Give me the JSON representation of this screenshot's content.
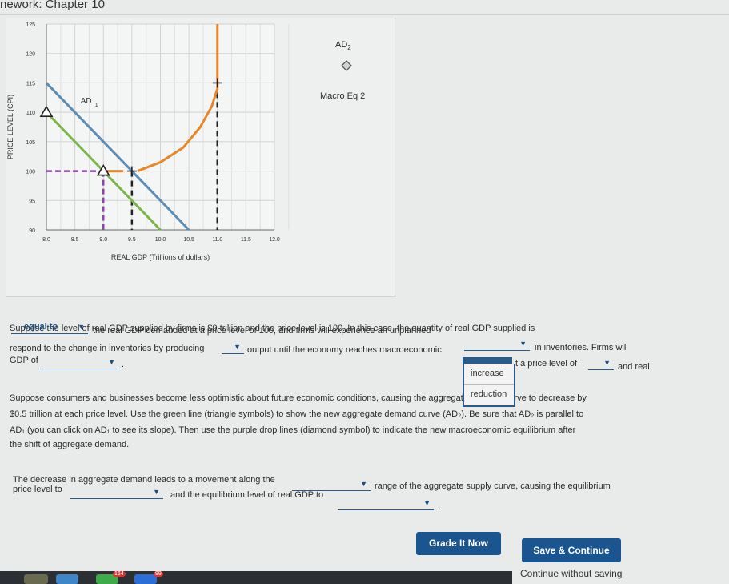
{
  "header": {
    "title": "nework: Chapter 10"
  },
  "chart_data": {
    "type": "line",
    "xlabel": "REAL GDP (Trillions of dollars)",
    "ylabel": "PRICE LEVEL (CPI)",
    "xlim": [
      8.0,
      12.0
    ],
    "ylim": [
      90,
      125
    ],
    "x_ticks": [
      "8.0",
      "8.5",
      "9.0",
      "9.5",
      "10.0",
      "10.5",
      "11.0",
      "11.5",
      "12.0"
    ],
    "y_ticks": [
      "90",
      "95",
      "100",
      "105",
      "110",
      "115",
      "120",
      "125"
    ],
    "grid": true,
    "series": [
      {
        "name": "AD1",
        "color": "#5b8db5",
        "points": [
          [
            8.0,
            115
          ],
          [
            10.5,
            90
          ]
        ]
      },
      {
        "name": "AD2",
        "color": "#7ab648",
        "points": [
          [
            8.0,
            110
          ],
          [
            10.0,
            90
          ]
        ],
        "markers": "triangle",
        "marker_points": [
          [
            8.0,
            110
          ],
          [
            9.0,
            100
          ]
        ]
      },
      {
        "name": "AS",
        "color": "#e8872a",
        "points": [
          [
            9.0,
            100
          ],
          [
            9.35,
            100
          ],
          [
            9.6,
            100
          ],
          [
            10.0,
            101.5
          ],
          [
            10.4,
            104
          ],
          [
            10.7,
            107.5
          ],
          [
            10.9,
            111
          ],
          [
            11.0,
            114
          ],
          [
            11.0,
            115
          ],
          [
            11.0,
            125
          ]
        ],
        "markers": "cross",
        "marker_points": [
          [
            9.5,
            100
          ],
          [
            11.0,
            115
          ]
        ]
      },
      {
        "name": "Macro Eq 2",
        "color": "#8e44ad",
        "drop_point": [
          9.0,
          100
        ]
      }
    ],
    "black_drop_lines": [
      [
        9.5,
        100
      ],
      [
        11.0,
        115
      ]
    ],
    "labels": {
      "ad1": "AD",
      "ad1_sub": "1"
    }
  },
  "legend": {
    "ad2_label": "AD",
    "ad2_sub": "2",
    "macro_eq_label": "Macro Eq 2"
  },
  "q1": {
    "line1": "Suppose the level of real GDP supplied by firms is $9 trillion and the price level is 100. In this case, the quantity of real GDP supplied is",
    "dd1": "equal to",
    "line2": "the real GDP demanded at a price level of 100, and firms will experience an unplanned",
    "line2b": "in inventories. Firms will",
    "line3": "respond to the change in inventories by producing",
    "line3b": "output until the economy reaches macroeconomic",
    "line4a": "GDP of",
    "line4b": ".",
    "line4c": "t a price level of",
    "line4d": "and real",
    "menu_options": [
      "increase",
      "reduction"
    ]
  },
  "q2": {
    "line1": "Suppose consumers and businesses become less optimistic about future economic conditions, causing the aggregate demand curve to decrease by",
    "line2": "$0.5 trillion at each price level. Use the green line (triangle symbols) to show the new aggregate demand curve (AD₂). Be sure that AD₂ is parallel to",
    "line3": "AD₁ (you can click on AD₁ to see its slope). Then use the purple drop lines (diamond symbol) to indicate the new macroeconomic equilibrium after",
    "line4": "the shift of aggregate demand."
  },
  "q3": {
    "line1": "The decrease in aggregate demand leads to a movement along the",
    "line1b": "range of the aggregate supply curve, causing the equilibrium",
    "line2": "price level to",
    "line2b": "and the equilibrium level of real GDP to",
    "line2c": "."
  },
  "buttons": {
    "grade": "Grade It Now",
    "save": "Save & Continue",
    "continue": "Continue without saving"
  },
  "dock": {
    "badge1": "164",
    "badge2": "99"
  }
}
